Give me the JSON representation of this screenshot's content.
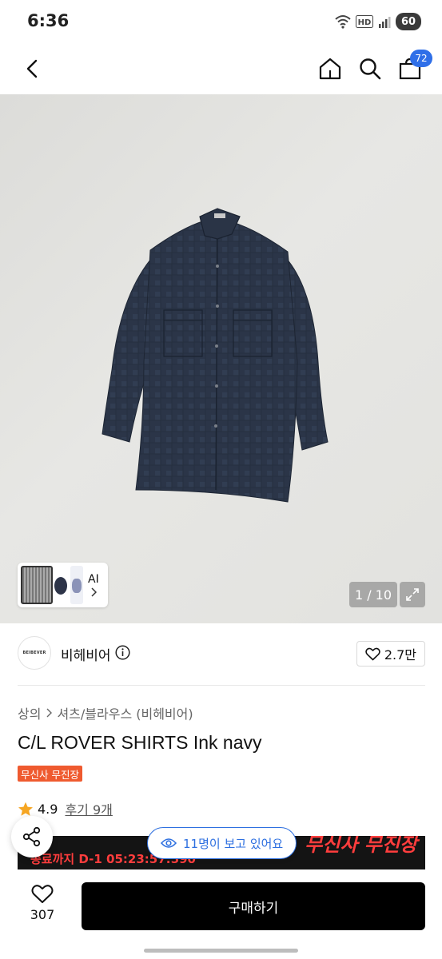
{
  "status_bar": {
    "time": "6:36",
    "battery": "60",
    "network_label": "HD"
  },
  "app_bar": {
    "cart_count": "72"
  },
  "gallery": {
    "thumb_label": "AI",
    "counter": "1 / 10"
  },
  "brand": {
    "logo_text": "BEIBEVER",
    "name": "비헤비어",
    "likes": "2.7만"
  },
  "breadcrumb": {
    "category": "상의",
    "subcategory": "셔츠/블라우스 (비헤비어)"
  },
  "product": {
    "title": "C/L ROVER SHIRTS Ink navy",
    "tag": "무신사 무진장"
  },
  "rating": {
    "score": "4.9",
    "reviews": "후기 9개"
  },
  "banner": {
    "countdown": "종료까지 D-1 05:23:57:590",
    "title": "무신사 무진장"
  },
  "viewers": {
    "text": "11명이 보고 있어요"
  },
  "bottom_bar": {
    "like_count": "307",
    "buy_label": "구매하기"
  },
  "colors": {
    "accent": "#2f6fe8",
    "tag_bg": "#ef5a2f",
    "banner_text": "#ff3d3d",
    "buy_bg": "#000000"
  }
}
